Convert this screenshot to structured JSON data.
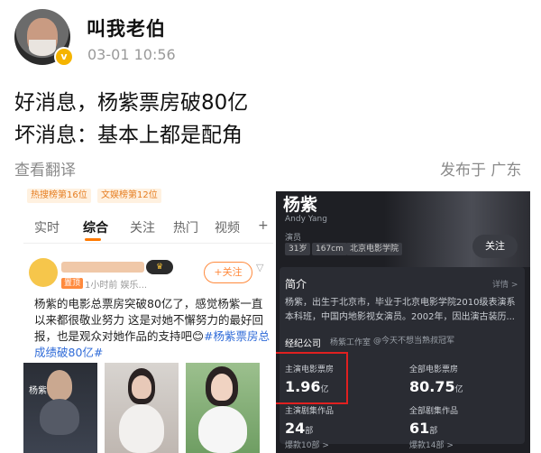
{
  "post": {
    "username": "叫我老伯",
    "timestamp": "03-01 10:56",
    "verified_badge": "v",
    "line1": "好消息，杨紫票房破80亿",
    "line2": "坏消息：基本上都是配角",
    "translate_label": "查看翻译",
    "location": "发布于 广东"
  },
  "left_shot": {
    "tags": [
      "热搜榜第16位",
      "文娱榜第12位"
    ],
    "tabs": [
      "实时",
      "综合",
      "关注",
      "热门",
      "视频",
      "+"
    ],
    "active_tab": "综合",
    "post_badge": "♛",
    "top_label": "置顶",
    "meta": "1小时前  娱乐...",
    "follow_label": "+关注",
    "text_main": "杨紫的电影总票房突破80亿了，感觉杨紫一直以来都很敬业努力 这是对她不懈努力的最好回报，也是观众对她作品的支持吧",
    "text_tag": "#杨紫票房总成绩破80亿#",
    "thumb_label": "杨紫"
  },
  "right_shot": {
    "name": "杨紫",
    "en_name": "Andy Yang",
    "role": "演员",
    "chips": [
      "31岁",
      "167cm",
      "北京电影学院"
    ],
    "follow_label": "关注",
    "intro_title": "简介",
    "detail_label": "详情 >",
    "bio": "杨紫，出生于北京市，毕业于北京电影学院2010级表演系本科班，中国内地影视女演员。2002年，因出演古装历...",
    "company_label": "经纪公司",
    "company_value": "杨紫工作室",
    "company_note": "@今天不想当熟叔冠军",
    "stats": [
      {
        "label": "主演电影票房",
        "value": "1.96",
        "unit": "亿"
      },
      {
        "label": "全部电影票房",
        "value": "80.75",
        "unit": "亿"
      },
      {
        "label": "主演剧集作品",
        "value": "24",
        "unit": "部",
        "sub": "爆款10部 >"
      },
      {
        "label": "全部剧集作品",
        "value": "61",
        "unit": "部",
        "sub": "爆款14部 >"
      }
    ]
  },
  "colors": {
    "accent": "#ff7a00",
    "highlight_box": "#e02020",
    "link": "#2f6bd8",
    "badge": "#f5b400"
  }
}
